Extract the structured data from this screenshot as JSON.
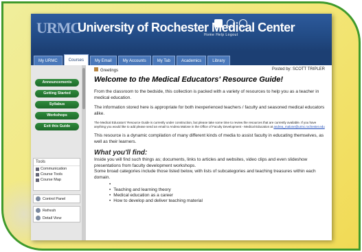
{
  "banner": {
    "logo": "URMC",
    "title": "University of Rochester Medical Center",
    "links": "Home  Help  Logout"
  },
  "tabs": [
    "My URMC",
    "Courses",
    "My Email",
    "My Accounts",
    "My Tab",
    "Academics",
    "Library"
  ],
  "active_tab_index": 1,
  "sidebar": {
    "buttons": [
      "Announcements",
      "Getting Started",
      "Syllabus",
      "Workshops",
      "Exit this Guide"
    ],
    "tools_title": "Tools",
    "tools": [
      "Communication",
      "Course Tools",
      "Course Map"
    ],
    "control_panel": "Control Panel",
    "refresh": "Refresh",
    "detail_view": "Detail View"
  },
  "content": {
    "crumb": "Greetings",
    "posted_by": "Posted by: SCOTT TRIPLER",
    "heading": "Welcome to the Medical Educators' Resource Guide!",
    "p1": "From the classroom to the bedside, this collection is packed with a variety of resources to help you as a teacher in medical education.",
    "p2": "The information stored here is appropriate for both inexperienced teachers / faculty and seasoned medical educators alike.",
    "p3_tiny": "The Medical Educators' Resource Guide is currently under construction, but please take some time to review the resources that are currently available. If you have anything you would like to add please send an email to Andrea Malone in the Office of Faculty Development - Medical Education at",
    "p3_email": "andrea_malone@urmc.rochester.edu",
    "p4": "This resource is a dynamic compilation of many different kinds of media to assist faculty in educating themselves, as well as their learners.",
    "subheading": "What you'll find:",
    "p5": "Inside you will find such things as; documents, links to articles and websites, video clips and even slideshow presentations from faculty development workshops.",
    "p6": "Some broad categories include those listed below, with lists of subcategories and teaching treasures within each domain.",
    "list": [
      "",
      "Teaching and learning theory",
      "Medical education as a career",
      "How to develop and deliver teaching material"
    ]
  },
  "colors": {
    "frame_border": "#3f9a2c",
    "banner": "#224b85",
    "nav_button": "#2f8a3c"
  }
}
